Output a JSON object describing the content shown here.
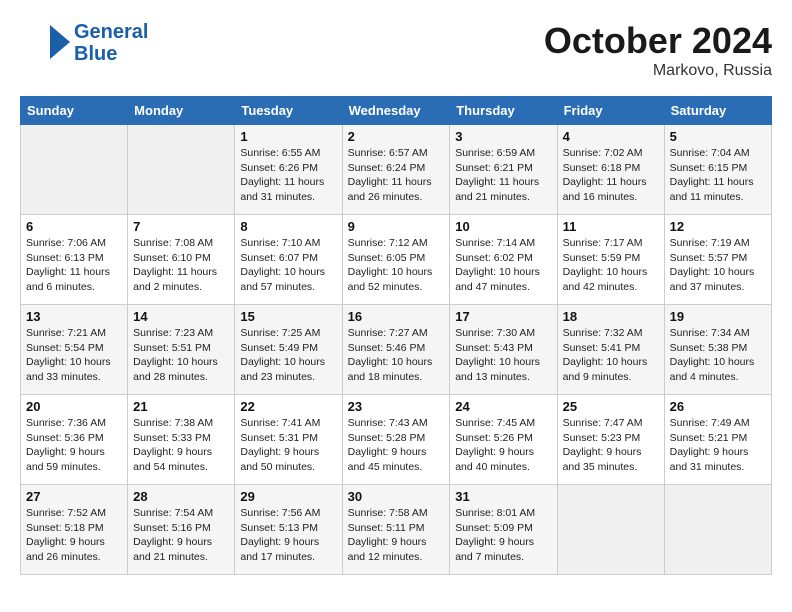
{
  "header": {
    "logo_line1": "General",
    "logo_line2": "Blue",
    "month": "October 2024",
    "location": "Markovo, Russia"
  },
  "weekdays": [
    "Sunday",
    "Monday",
    "Tuesday",
    "Wednesday",
    "Thursday",
    "Friday",
    "Saturday"
  ],
  "weeks": [
    [
      {
        "day": "",
        "info": ""
      },
      {
        "day": "",
        "info": ""
      },
      {
        "day": "1",
        "info": "Sunrise: 6:55 AM\nSunset: 6:26 PM\nDaylight: 11 hours and 31 minutes."
      },
      {
        "day": "2",
        "info": "Sunrise: 6:57 AM\nSunset: 6:24 PM\nDaylight: 11 hours and 26 minutes."
      },
      {
        "day": "3",
        "info": "Sunrise: 6:59 AM\nSunset: 6:21 PM\nDaylight: 11 hours and 21 minutes."
      },
      {
        "day": "4",
        "info": "Sunrise: 7:02 AM\nSunset: 6:18 PM\nDaylight: 11 hours and 16 minutes."
      },
      {
        "day": "5",
        "info": "Sunrise: 7:04 AM\nSunset: 6:15 PM\nDaylight: 11 hours and 11 minutes."
      }
    ],
    [
      {
        "day": "6",
        "info": "Sunrise: 7:06 AM\nSunset: 6:13 PM\nDaylight: 11 hours and 6 minutes."
      },
      {
        "day": "7",
        "info": "Sunrise: 7:08 AM\nSunset: 6:10 PM\nDaylight: 11 hours and 2 minutes."
      },
      {
        "day": "8",
        "info": "Sunrise: 7:10 AM\nSunset: 6:07 PM\nDaylight: 10 hours and 57 minutes."
      },
      {
        "day": "9",
        "info": "Sunrise: 7:12 AM\nSunset: 6:05 PM\nDaylight: 10 hours and 52 minutes."
      },
      {
        "day": "10",
        "info": "Sunrise: 7:14 AM\nSunset: 6:02 PM\nDaylight: 10 hours and 47 minutes."
      },
      {
        "day": "11",
        "info": "Sunrise: 7:17 AM\nSunset: 5:59 PM\nDaylight: 10 hours and 42 minutes."
      },
      {
        "day": "12",
        "info": "Sunrise: 7:19 AM\nSunset: 5:57 PM\nDaylight: 10 hours and 37 minutes."
      }
    ],
    [
      {
        "day": "13",
        "info": "Sunrise: 7:21 AM\nSunset: 5:54 PM\nDaylight: 10 hours and 33 minutes."
      },
      {
        "day": "14",
        "info": "Sunrise: 7:23 AM\nSunset: 5:51 PM\nDaylight: 10 hours and 28 minutes."
      },
      {
        "day": "15",
        "info": "Sunrise: 7:25 AM\nSunset: 5:49 PM\nDaylight: 10 hours and 23 minutes."
      },
      {
        "day": "16",
        "info": "Sunrise: 7:27 AM\nSunset: 5:46 PM\nDaylight: 10 hours and 18 minutes."
      },
      {
        "day": "17",
        "info": "Sunrise: 7:30 AM\nSunset: 5:43 PM\nDaylight: 10 hours and 13 minutes."
      },
      {
        "day": "18",
        "info": "Sunrise: 7:32 AM\nSunset: 5:41 PM\nDaylight: 10 hours and 9 minutes."
      },
      {
        "day": "19",
        "info": "Sunrise: 7:34 AM\nSunset: 5:38 PM\nDaylight: 10 hours and 4 minutes."
      }
    ],
    [
      {
        "day": "20",
        "info": "Sunrise: 7:36 AM\nSunset: 5:36 PM\nDaylight: 9 hours and 59 minutes."
      },
      {
        "day": "21",
        "info": "Sunrise: 7:38 AM\nSunset: 5:33 PM\nDaylight: 9 hours and 54 minutes."
      },
      {
        "day": "22",
        "info": "Sunrise: 7:41 AM\nSunset: 5:31 PM\nDaylight: 9 hours and 50 minutes."
      },
      {
        "day": "23",
        "info": "Sunrise: 7:43 AM\nSunset: 5:28 PM\nDaylight: 9 hours and 45 minutes."
      },
      {
        "day": "24",
        "info": "Sunrise: 7:45 AM\nSunset: 5:26 PM\nDaylight: 9 hours and 40 minutes."
      },
      {
        "day": "25",
        "info": "Sunrise: 7:47 AM\nSunset: 5:23 PM\nDaylight: 9 hours and 35 minutes."
      },
      {
        "day": "26",
        "info": "Sunrise: 7:49 AM\nSunset: 5:21 PM\nDaylight: 9 hours and 31 minutes."
      }
    ],
    [
      {
        "day": "27",
        "info": "Sunrise: 7:52 AM\nSunset: 5:18 PM\nDaylight: 9 hours and 26 minutes."
      },
      {
        "day": "28",
        "info": "Sunrise: 7:54 AM\nSunset: 5:16 PM\nDaylight: 9 hours and 21 minutes."
      },
      {
        "day": "29",
        "info": "Sunrise: 7:56 AM\nSunset: 5:13 PM\nDaylight: 9 hours and 17 minutes."
      },
      {
        "day": "30",
        "info": "Sunrise: 7:58 AM\nSunset: 5:11 PM\nDaylight: 9 hours and 12 minutes."
      },
      {
        "day": "31",
        "info": "Sunrise: 8:01 AM\nSunset: 5:09 PM\nDaylight: 9 hours and 7 minutes."
      },
      {
        "day": "",
        "info": ""
      },
      {
        "day": "",
        "info": ""
      }
    ]
  ]
}
